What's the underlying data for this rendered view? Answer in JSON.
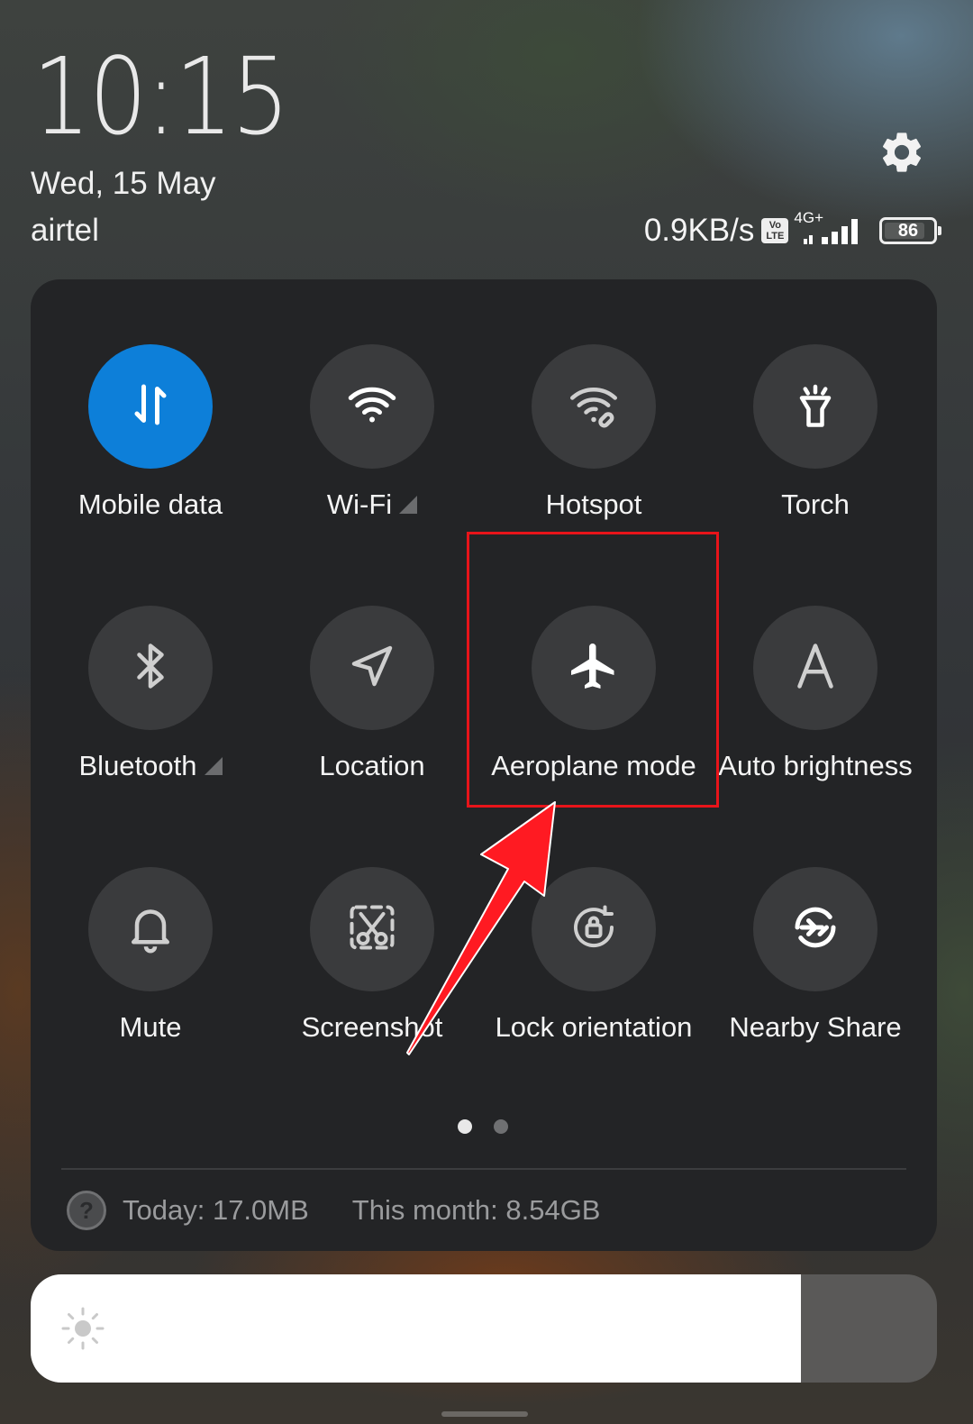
{
  "status": {
    "time": "10:15",
    "date": "Wed, 15 May",
    "carrier": "airtel",
    "net_speed": "0.9KB/s",
    "volte_badge": "Vo LTE",
    "network_type": "4G+",
    "battery_level": 86,
    "icons": [
      "settings-gear-icon",
      "volte-icon",
      "signal-bars-icon",
      "battery-icon"
    ]
  },
  "tiles": [
    {
      "id": "mobile-data",
      "label": "Mobile data",
      "icon": "mobile-data-arrows-icon",
      "active": true,
      "expandable": false
    },
    {
      "id": "wifi",
      "label": "Wi-Fi",
      "icon": "wifi-icon",
      "active": false,
      "expandable": true
    },
    {
      "id": "hotspot",
      "label": "Hotspot",
      "icon": "hotspot-icon",
      "active": false,
      "expandable": false
    },
    {
      "id": "torch",
      "label": "Torch",
      "icon": "torch-icon",
      "active": false,
      "expandable": false
    },
    {
      "id": "bluetooth",
      "label": "Bluetooth",
      "icon": "bluetooth-icon",
      "active": false,
      "expandable": true
    },
    {
      "id": "location",
      "label": "Location",
      "icon": "location-arrow-icon",
      "active": false,
      "expandable": false
    },
    {
      "id": "aeroplane",
      "label": "Aeroplane mode",
      "icon": "aeroplane-icon",
      "active": false,
      "expandable": false
    },
    {
      "id": "auto-brightness",
      "label": "Auto brightness",
      "icon": "letter-a-icon",
      "active": false,
      "expandable": false
    },
    {
      "id": "mute",
      "label": "Mute",
      "icon": "bell-icon",
      "active": false,
      "expandable": false
    },
    {
      "id": "screenshot",
      "label": "Screenshot",
      "icon": "scissors-icon",
      "active": false,
      "expandable": false
    },
    {
      "id": "lock-orientation",
      "label": "Lock orientation",
      "icon": "rotation-lock-icon",
      "active": false,
      "expandable": false
    },
    {
      "id": "nearby-share",
      "label": "Nearby Share",
      "icon": "nearby-share-icon",
      "active": false,
      "expandable": false
    }
  ],
  "pager": {
    "pages": 2,
    "current": 1
  },
  "usage": {
    "today": "Today: 17.0MB",
    "month": "This month: 8.54GB",
    "help_glyph": "?"
  },
  "brightness": {
    "level": 0.85,
    "icon": "sun-icon"
  },
  "colors": {
    "active_tile": "#0d7fd9",
    "tile_bg": "#3a3b3d",
    "panel_bg": "#232426",
    "annotation": "#e8141a"
  },
  "annotation": {
    "target": "aeroplane",
    "arrow_color": "#ff1a22"
  }
}
